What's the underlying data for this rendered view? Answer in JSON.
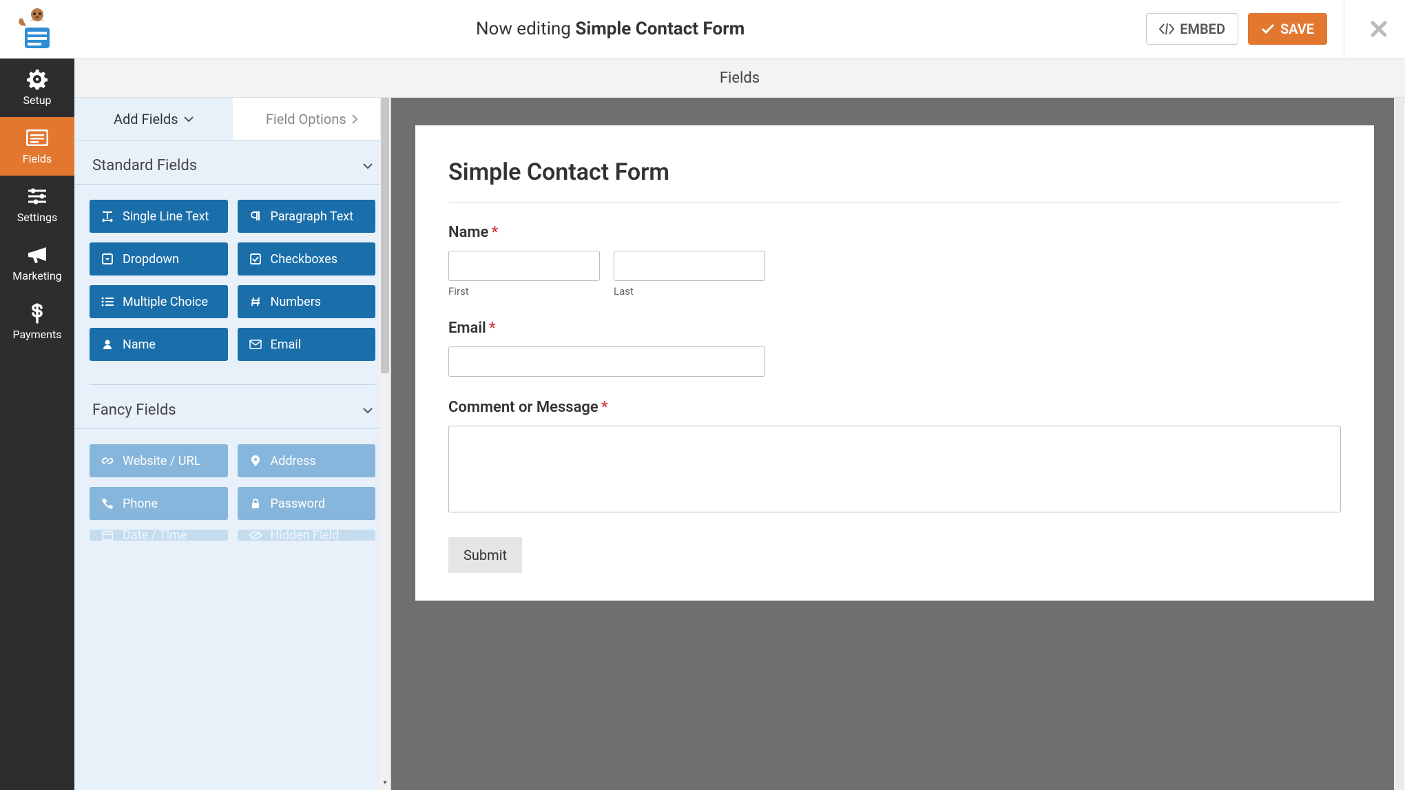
{
  "topbar": {
    "editing_prefix": "Now editing",
    "form_name": "Simple Contact Form",
    "embed_label": "EMBED",
    "save_label": "SAVE"
  },
  "leftnav": {
    "items": [
      {
        "label": "Setup"
      },
      {
        "label": "Fields"
      },
      {
        "label": "Settings"
      },
      {
        "label": "Marketing"
      },
      {
        "label": "Payments"
      }
    ]
  },
  "middle_title": "Fields",
  "tabs": {
    "add_fields": "Add Fields",
    "field_options": "Field Options"
  },
  "sections": {
    "standard": {
      "title": "Standard Fields",
      "fields": [
        {
          "label": "Single Line Text",
          "icon": "text-width"
        },
        {
          "label": "Paragraph Text",
          "icon": "paragraph"
        },
        {
          "label": "Dropdown",
          "icon": "caret-square"
        },
        {
          "label": "Checkboxes",
          "icon": "check-square"
        },
        {
          "label": "Multiple Choice",
          "icon": "list"
        },
        {
          "label": "Numbers",
          "icon": "hash"
        },
        {
          "label": "Name",
          "icon": "user"
        },
        {
          "label": "Email",
          "icon": "envelope"
        }
      ]
    },
    "fancy": {
      "title": "Fancy Fields",
      "fields": [
        {
          "label": "Website / URL",
          "icon": "link"
        },
        {
          "label": "Address",
          "icon": "pin"
        },
        {
          "label": "Phone",
          "icon": "phone"
        },
        {
          "label": "Password",
          "icon": "lock"
        },
        {
          "label": "Date / Time",
          "icon": "calendar"
        },
        {
          "label": "Hidden Field",
          "icon": "eye-slash"
        }
      ]
    }
  },
  "form": {
    "title": "Simple Contact Form",
    "name_label": "Name",
    "first_label": "First",
    "last_label": "Last",
    "email_label": "Email",
    "comment_label": "Comment or Message",
    "submit_label": "Submit",
    "required_marker": "*"
  }
}
